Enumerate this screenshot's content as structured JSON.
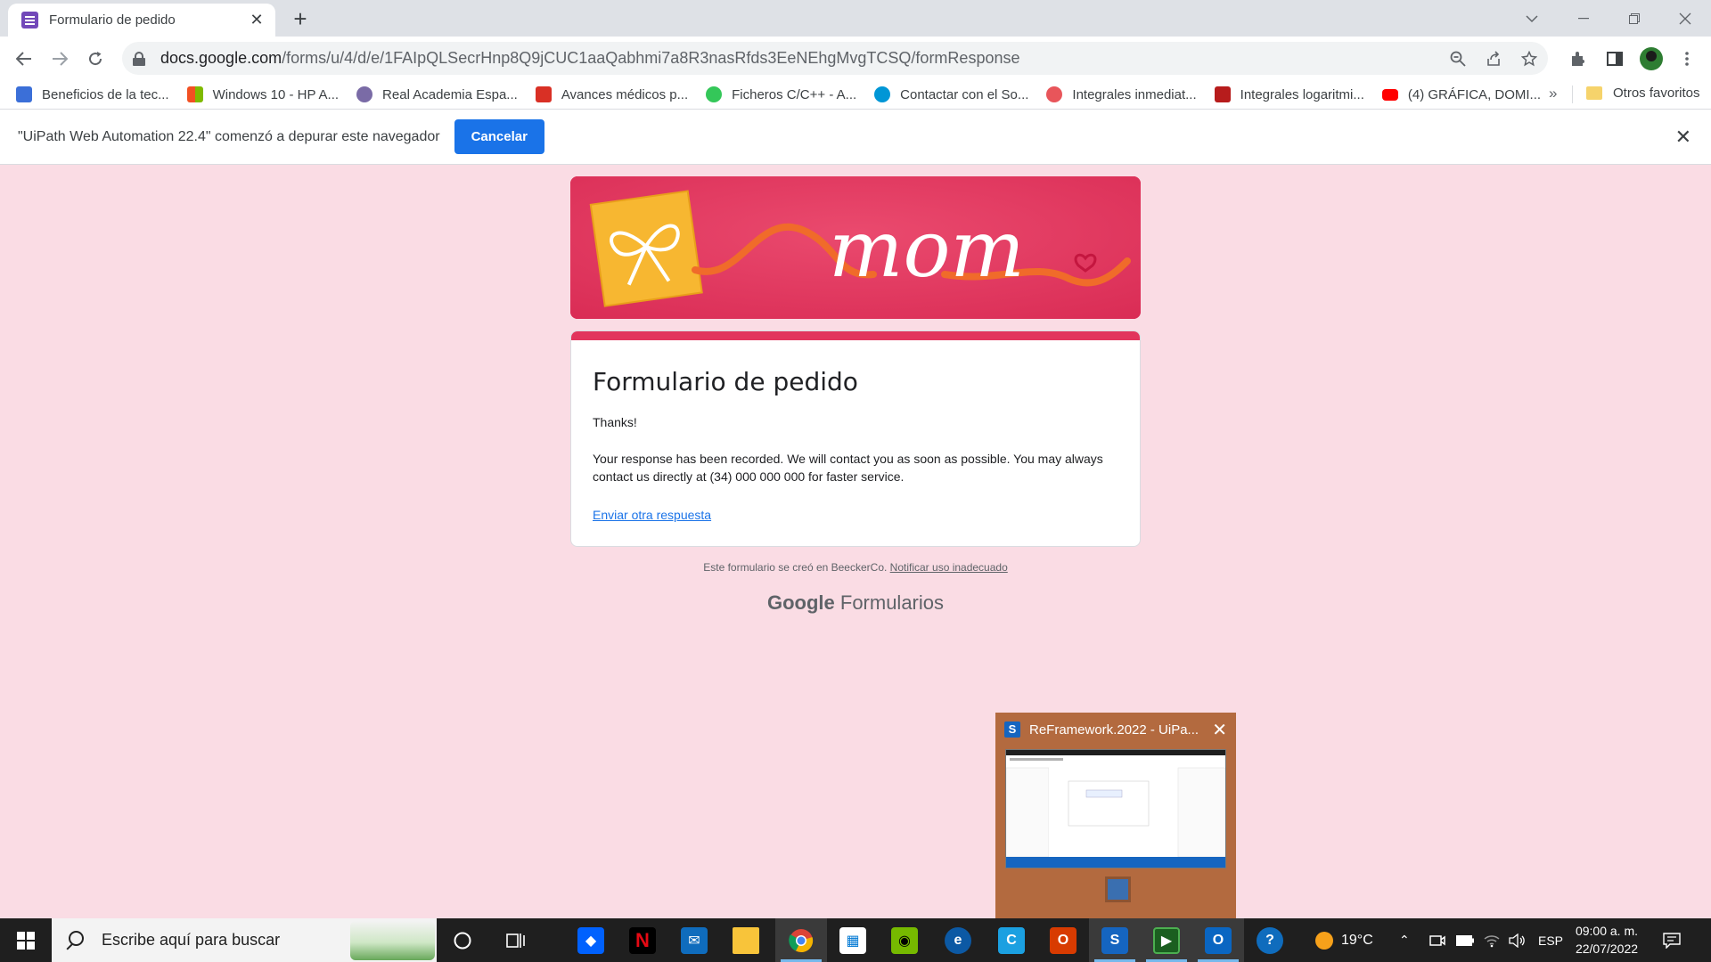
{
  "browser": {
    "tab_title": "Formulario de pedido",
    "tab_close": "✕",
    "new_tab": "+",
    "url_host": "docs.google.com",
    "url_path": "/forms/u/4/d/e/1FAIpQLSecrHnp8Q9jCUC1aaQabhmi7a8R3nasRfds3EeNEhgMvgTCSQ/formResponse",
    "bookmarks": [
      {
        "label": "Beneficios de la tec...",
        "color": "#3b6fd8"
      },
      {
        "label": "Windows 10 - HP A...",
        "color": "#f25022"
      },
      {
        "label": "Real Academia Espa...",
        "color": "#7a6ba6"
      },
      {
        "label": "Avances médicos p...",
        "color": "#d93025"
      },
      {
        "label": "Ficheros C/C++ - A...",
        "color": "#34c759"
      },
      {
        "label": "Contactar con el So...",
        "color": "#0096d6"
      },
      {
        "label": "Integrales inmediat...",
        "color": "#e8555a"
      },
      {
        "label": "Integrales logaritmi...",
        "color": "#b71c1c"
      },
      {
        "label": "(4) GRÁFICA, DOMI...",
        "color": "#ff0000"
      }
    ],
    "bookmarks_more": "»",
    "other_bookmarks": "Otros favoritos"
  },
  "infobar": {
    "message": "\"UiPath Web Automation 22.4\" comenzó a depurar este navegador",
    "cancel_label": "Cancelar",
    "close": "✕"
  },
  "form": {
    "title": "Formulario de pedido",
    "thanks": "Thanks!",
    "message": "Your response has been recorded. We will contact you as soon as possible. You may always contact us directly at (34) 000 000 000 for faster service.",
    "another_response": "Enviar otra respuesta",
    "footer_text": "Este formulario se creó en BeeckerCo.",
    "report_link": "Notificar uso inadecuado",
    "brand_google": "Google",
    "brand_forms": "Formularios",
    "header_word": "mom",
    "accent_color": "#e2345c",
    "background_color": "#fadce4"
  },
  "thumbnail": {
    "title": "ReFramework.2022 - UiPa...",
    "close": "✕"
  },
  "taskbar": {
    "search_placeholder": "Escribe aquí para buscar",
    "temperature": "19°C",
    "language": "ESP",
    "time": "09:00 a. m.",
    "date": "22/07/2022"
  }
}
